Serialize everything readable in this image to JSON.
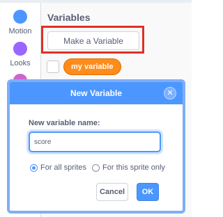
{
  "sidebar": {
    "categories": [
      {
        "label": "Motion",
        "color": "#4c97ff"
      },
      {
        "label": "Looks",
        "color": "#9966ff"
      },
      {
        "label": "",
        "color": "#cf63cf"
      }
    ]
  },
  "palette": {
    "title": "Variables",
    "make_variable_label": "Make a Variable",
    "variable_pill_label": "my variable",
    "highlight_color": "#e12f24",
    "variable_color": "#ff8c1a"
  },
  "dialog": {
    "title": "New Variable",
    "close_icon": "close-icon",
    "field_label": "New variable name:",
    "input_value": "score",
    "radio_options": [
      {
        "label": "For all sprites",
        "checked": true
      },
      {
        "label": "For this sprite only",
        "checked": false
      }
    ],
    "cancel_label": "Cancel",
    "ok_label": "OK",
    "header_color": "#4c97ff"
  }
}
